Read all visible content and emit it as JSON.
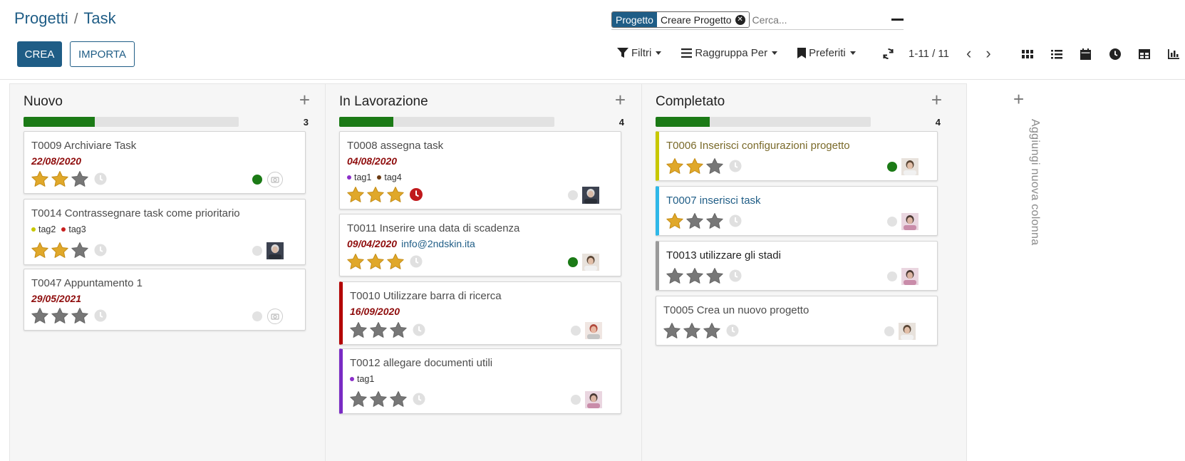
{
  "breadcrumb": {
    "parent": "Progetti",
    "separator": "/",
    "current": "Task"
  },
  "buttons": {
    "create": "CREA",
    "import": "IMPORTA"
  },
  "search": {
    "facet_title": "Progetto",
    "facet_value": "Creare Progetto",
    "placeholder": "Cerca..."
  },
  "filters": {
    "filter": "Filtri",
    "group_by": "Raggruppa Per",
    "favorites": "Preferiti"
  },
  "pager": {
    "value": "1-11 / 11"
  },
  "views": [
    "kanban-view-icon",
    "list-view-icon",
    "calendar-view-icon",
    "activity-view-icon",
    "pivot-view-icon",
    "graph-view-icon"
  ],
  "columns": [
    {
      "title": "Nuovo",
      "count": "3",
      "progress": 0.33,
      "cards": [
        {
          "title": "T0009 Archiviare Task",
          "date": "22/08/2020",
          "stars": 2,
          "status": "green",
          "avatar": "placeholder"
        },
        {
          "title": "T0014 Contrassegnare task come prioritario",
          "tags": [
            {
              "label": "tag2",
              "color": "#c8c800"
            },
            {
              "label": "tag3",
              "color": "#c8201f"
            }
          ],
          "stars": 2,
          "status": "grey",
          "avatar": "man-glasses"
        },
        {
          "title": "T0047 Appuntamento 1",
          "date": "29/05/2021",
          "stars": 0,
          "status": "grey",
          "avatar": "placeholder"
        }
      ]
    },
    {
      "title": "In Lavorazione",
      "count": "4",
      "progress": 0.25,
      "cards": [
        {
          "title": "T0008 assegna task",
          "date": "04/08/2020",
          "tags": [
            {
              "label": "tag1",
              "color": "#8b2fc9"
            },
            {
              "label": "tag4",
              "color": "#6b3a12"
            }
          ],
          "stars": 3,
          "clock": "overdue",
          "status": "grey",
          "avatar": "man-glasses"
        },
        {
          "title": "T0011 Inserire una data di scadenza",
          "date": "09/04/2020",
          "email": "info@2ndskin.ita",
          "stars": 3,
          "status": "green",
          "avatar": "woman"
        },
        {
          "title": "T0010 Utilizzare barra di ricerca",
          "date": "16/09/2020",
          "stars": 0,
          "status": "grey",
          "avatar": "woman-red",
          "accent": "#b30000"
        },
        {
          "title": "T0012 allegare documenti utili",
          "tags": [
            {
              "label": "tag1",
              "color": "#8b2fc9"
            }
          ],
          "stars": 0,
          "status": "grey",
          "avatar": "man-pink",
          "accent": "#7a2bc4"
        }
      ]
    },
    {
      "title": "Completato",
      "count": "4",
      "progress": 0.25,
      "cards": [
        {
          "title": "T0006 Inserisci configurazioni progetto",
          "stars": 2,
          "status": "green",
          "avatar": "woman",
          "accent": "#c8c800",
          "title_color": "#7a6a2a"
        },
        {
          "title": "T0007 inserisci task",
          "stars": 1,
          "status": "grey",
          "avatar": "man-pink",
          "accent": "#2fb8e8",
          "title_color": "#1f5d86"
        },
        {
          "title": "T0013 utilizzare gli stadi",
          "stars": 0,
          "status": "grey",
          "avatar": "man-pink",
          "accent": "#9a9a9a",
          "title_color": "#222"
        },
        {
          "title": "T0005 Crea un nuovo progetto",
          "stars": 0,
          "status": "grey",
          "avatar": "woman"
        }
      ]
    }
  ],
  "add_column": {
    "label": "Aggiungi nuova colonna"
  },
  "colors": {
    "primary": "#1f5d86",
    "progress": "#1b7a16",
    "star_on": "#e0a82a",
    "star_off": "#777777",
    "date": "#8f0d0d"
  }
}
